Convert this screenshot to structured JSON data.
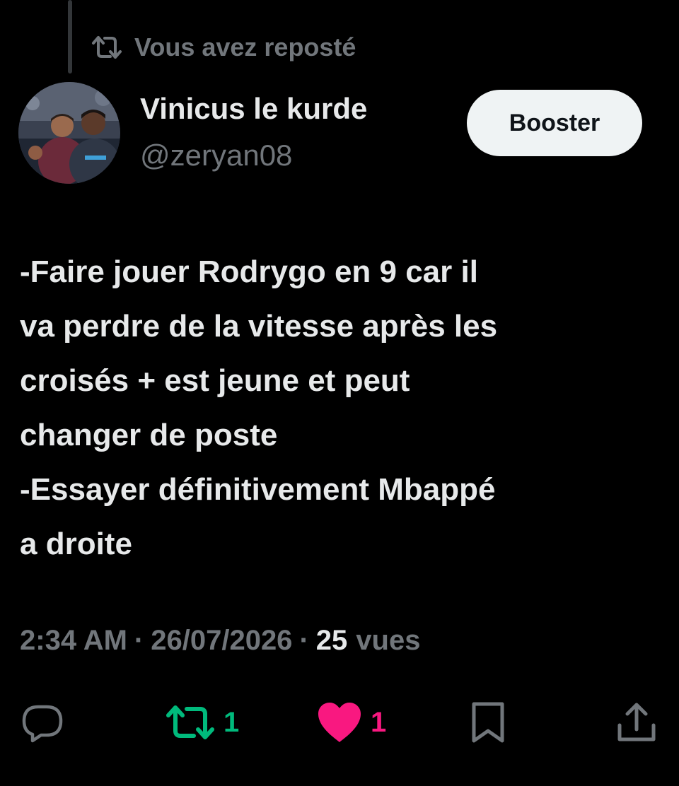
{
  "repost_banner": {
    "icon": "repost-icon",
    "text": "Vous avez reposté"
  },
  "author": {
    "display_name": "Vinicus le kurde",
    "handle": "@zeryan08",
    "avatar": "avatar-photo"
  },
  "follow_button": {
    "label": "Booster"
  },
  "tweet": {
    "lines": [
      "-Faire jouer Rodrygo en 9 car il",
      "va perdre de la vitesse après les",
      "croisés + est jeune et peut",
      "changer de poste",
      "-Essayer définitivement Mbappé",
      "a droite"
    ]
  },
  "meta": {
    "time": "2:34 AM",
    "separator": "·",
    "date": "26/07/2026",
    "views_count": "25",
    "views_label": "vues"
  },
  "actions": {
    "reply": {
      "icon": "reply-icon"
    },
    "repost": {
      "icon": "repost-icon",
      "count": "1",
      "active": true,
      "color": "#00ba7c"
    },
    "like": {
      "icon": "heart-icon",
      "count": "1",
      "active": true,
      "color": "#f91880"
    },
    "bookmark": {
      "icon": "bookmark-icon"
    },
    "share": {
      "icon": "share-icon"
    }
  },
  "colors": {
    "background": "#000000",
    "text_primary": "#e7e9ea",
    "text_secondary": "#71767b",
    "button_bg": "#eff3f4",
    "repost_green": "#00ba7c",
    "like_pink": "#f91880"
  }
}
